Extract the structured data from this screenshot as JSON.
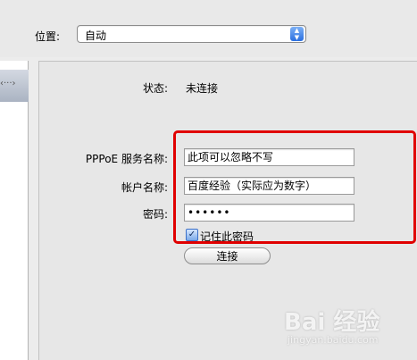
{
  "location": {
    "label": "位置:",
    "value": "自动"
  },
  "status": {
    "label": "状态:",
    "value": "未连接"
  },
  "pppoe": {
    "service_label": "PPPoE 服务名称:",
    "service_value": "此项可以忽略不写",
    "account_label": "帐户名称:",
    "account_value": "百度经验（实际应为数字）",
    "password_label": "密码:",
    "password_value": "••••••",
    "remember_label": "记住此密码",
    "remember_checked": true,
    "connect_label": "连接"
  },
  "colors": {
    "highlight": "#e00000",
    "accent": "#2a6fe0"
  },
  "watermark": {
    "mark": "Bai 经验",
    "sub": "jingyan.baidu.com"
  }
}
